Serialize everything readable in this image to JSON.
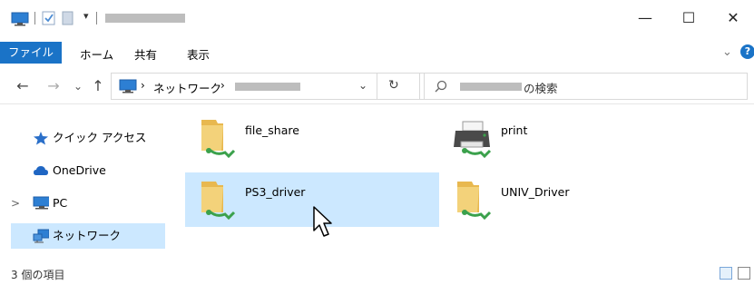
{
  "window": {
    "title_redacted": true,
    "controls": {
      "minimize": "—",
      "maximize": "☐",
      "close": "✕"
    }
  },
  "ribbon": {
    "tabs": [
      "ファイル",
      "ホーム",
      "共有",
      "表示"
    ],
    "right_chevron": "⌄",
    "help_glyph": "?"
  },
  "address": {
    "back": "←",
    "forward": "→",
    "recent": "⌄",
    "up": "↑",
    "separator": "›",
    "root": "ネットワーク",
    "refresh": "↻",
    "dropdown": "⌄",
    "search_suffix": "の検索"
  },
  "sidebar": {
    "items": [
      {
        "label": "クイック アクセス",
        "icon": "star-icon"
      },
      {
        "label": "OneDrive",
        "icon": "cloud-icon"
      },
      {
        "label": "PC",
        "icon": "pc-icon",
        "expander": ">"
      },
      {
        "label": "ネットワーク",
        "icon": "network-icon",
        "selected": true
      }
    ]
  },
  "content": {
    "items": [
      {
        "name": "file_share",
        "icon": "shared-folder-icon",
        "selected": false
      },
      {
        "name": "print",
        "icon": "printer-icon",
        "selected": false
      },
      {
        "name": "PS3_driver",
        "icon": "shared-folder-icon",
        "selected": true
      },
      {
        "name": "UNIV_Driver",
        "icon": "shared-folder-icon",
        "selected": false
      }
    ]
  },
  "status": {
    "text": "3 個の項目"
  },
  "colors": {
    "accent": "#1a73c7",
    "selection": "#cce8ff",
    "folder": "#e8b84f"
  }
}
